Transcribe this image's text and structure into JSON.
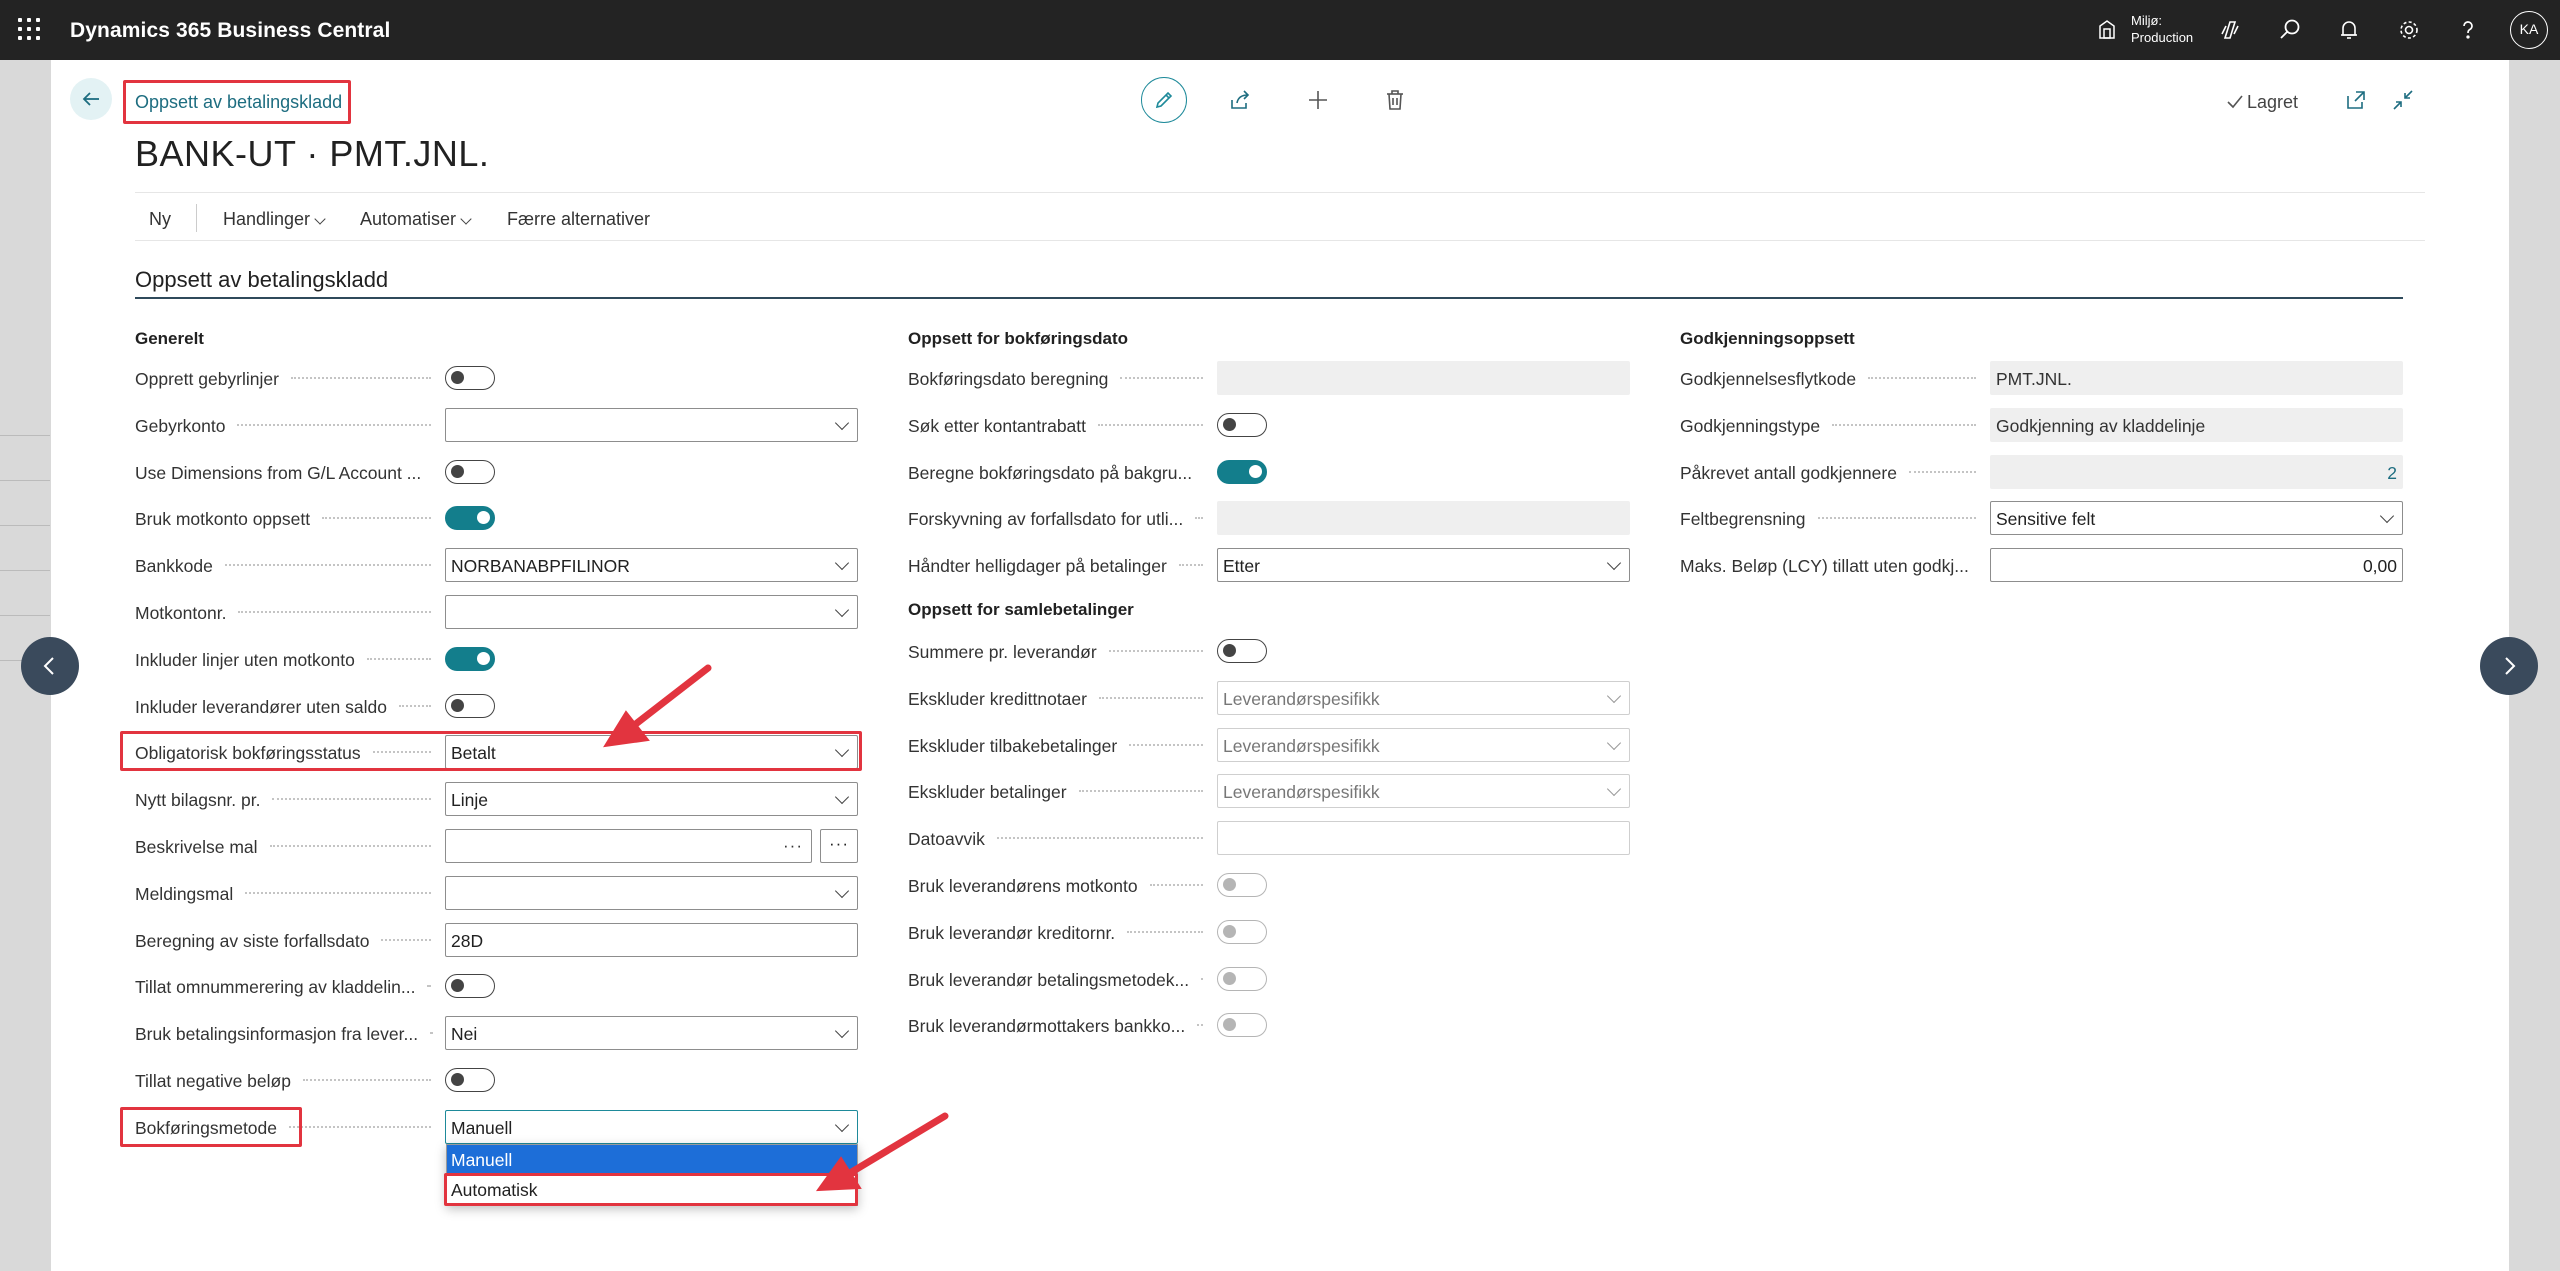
{
  "app": {
    "title": "Dynamics 365 Business Central",
    "env_label_line1": "Miljø:",
    "env_label_line2": "Production",
    "user_initials": "KA"
  },
  "page": {
    "breadcrumb": "Oppsett av betalingskladd",
    "title": "BANK-UT · PMT.JNL.",
    "saved_label": "Lagret"
  },
  "actions": {
    "new": "Ny",
    "actions": "Handlinger",
    "automate": "Automatiser",
    "fewer_options": "Færre alternativer"
  },
  "section": {
    "title": "Oppsett av betalingskladd"
  },
  "general": {
    "title": "Generelt",
    "fields": [
      {
        "label": "Opprett gebyrlinjer",
        "type": "toggle",
        "on": false
      },
      {
        "label": "Gebyrkonto",
        "type": "select",
        "value": ""
      },
      {
        "label": "Use Dimensions from G/L Account ...",
        "type": "toggle",
        "on": false
      },
      {
        "label": "Bruk motkonto oppsett",
        "type": "toggle",
        "on": true
      },
      {
        "label": "Bankkode",
        "type": "select",
        "value": "NORBANABPFILINOR"
      },
      {
        "label": "Motkontonr.",
        "type": "select",
        "value": ""
      },
      {
        "label": "Inkluder linjer uten motkonto",
        "type": "toggle",
        "on": true
      },
      {
        "label": "Inkluder leverandører uten saldo",
        "type": "toggle",
        "on": false
      },
      {
        "label": "Obligatorisk bokføringsstatus",
        "type": "select",
        "value": "Betalt"
      },
      {
        "label": "Nytt bilagsnr. pr.",
        "type": "select",
        "value": "Linje"
      },
      {
        "label": "Beskrivelse mal",
        "type": "ellipsis",
        "value": ""
      },
      {
        "label": "Meldingsmal",
        "type": "select",
        "value": ""
      },
      {
        "label": "Beregning av siste forfallsdato",
        "type": "text",
        "value": "28D"
      },
      {
        "label": "Tillat omnummerering av kladdelin...",
        "type": "toggle",
        "on": false
      },
      {
        "label": "Bruk betalingsinformasjon fra lever...",
        "type": "select",
        "value": "Nei"
      },
      {
        "label": "Tillat negative beløp",
        "type": "toggle",
        "on": false
      },
      {
        "label": "Bokføringsmetode",
        "type": "select",
        "value": "Manuell"
      }
    ],
    "dropdown_options": [
      "Manuell",
      "Automatisk"
    ]
  },
  "posting_date": {
    "title": "Oppsett for bokføringsdato",
    "fields": [
      {
        "label": "Bokføringsdato beregning",
        "type": "readonly",
        "value": ""
      },
      {
        "label": "Søk etter kontantrabatt",
        "type": "toggle",
        "on": false
      },
      {
        "label": "Beregne bokføringsdato på bakgru...",
        "type": "toggle",
        "on": true
      },
      {
        "label": "Forskyvning av forfallsdato for utli...",
        "type": "readonly",
        "value": ""
      },
      {
        "label": "Håndter helligdager på betalinger",
        "type": "select",
        "value": "Etter"
      }
    ]
  },
  "batch": {
    "title": "Oppsett for samlebetalinger",
    "fields": [
      {
        "label": "Summere pr. leverandør",
        "type": "toggle",
        "on": false
      },
      {
        "label": "Ekskluder kredittnotaer",
        "type": "select-disabled",
        "value": "Leverandørspesifikk"
      },
      {
        "label": "Ekskluder tilbakebetalinger",
        "type": "select-disabled",
        "value": "Leverandørspesifikk"
      },
      {
        "label": "Ekskluder betalinger",
        "type": "select-disabled",
        "value": "Leverandørspesifikk"
      },
      {
        "label": "Datoavvik",
        "type": "text-disabled",
        "value": ""
      },
      {
        "label": "Bruk leverandørens motkonto",
        "type": "toggle-disabled",
        "on": false
      },
      {
        "label": "Bruk leverandør kreditornr.",
        "type": "toggle-disabled",
        "on": false
      },
      {
        "label": "Bruk leverandør betalingsmetodek...",
        "type": "toggle-disabled",
        "on": false
      },
      {
        "label": "Bruk leverandørmottakers bankko...",
        "type": "toggle-disabled",
        "on": false
      }
    ]
  },
  "approval": {
    "title": "Godkjenningsoppsett",
    "fields": [
      {
        "label": "Godkjennelsesflytkode",
        "type": "readonly",
        "value": "PMT.JNL."
      },
      {
        "label": "Godkjenningstype",
        "type": "readonly",
        "value": "Godkjenning av kladdelinje"
      },
      {
        "label": "Påkrevet antall godkjennere",
        "type": "readonly-num",
        "value": "2"
      },
      {
        "label": "Feltbegrensning",
        "type": "select",
        "value": "Sensitive felt"
      },
      {
        "label": "Maks. Beløp (LCY) tillatt uten godkj...",
        "type": "number",
        "value": "0,00"
      }
    ]
  }
}
